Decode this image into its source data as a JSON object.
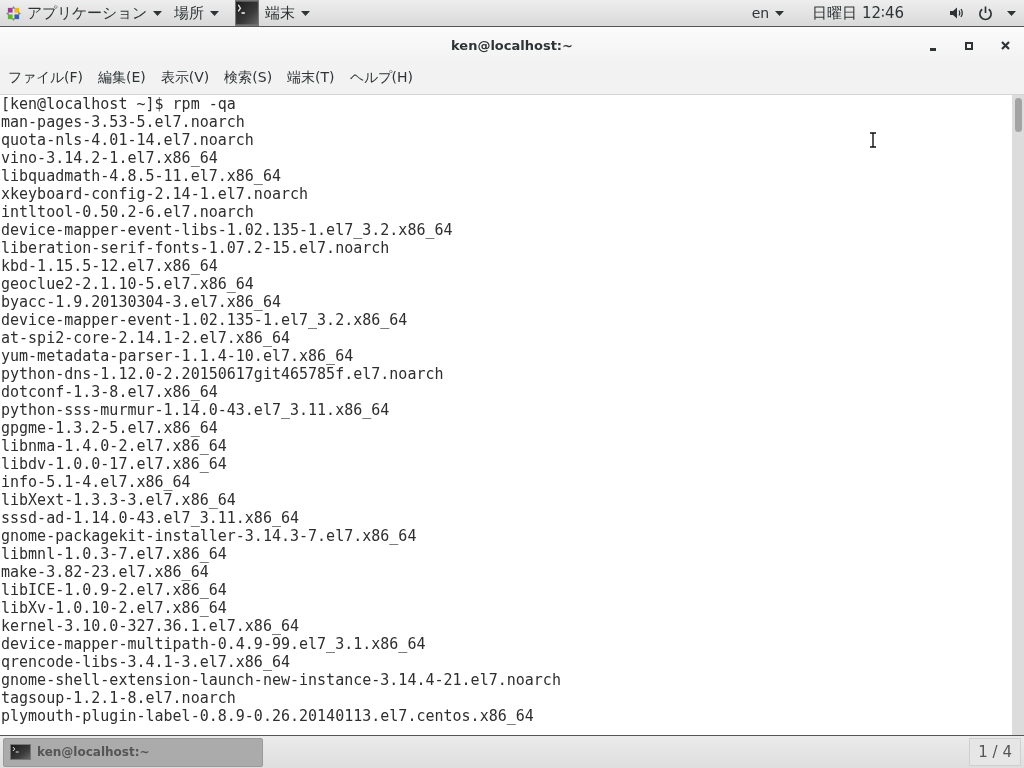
{
  "top_bar": {
    "menus": [
      {
        "kind": "applications",
        "label": "アプリケーション"
      },
      {
        "kind": "places",
        "label": "場所"
      }
    ],
    "active_app": {
      "label": "端末"
    },
    "input_method": "en",
    "clock": "日曜日 12∶46"
  },
  "window": {
    "title": "ken@localhost:~",
    "menu": [
      "ファイル(F)",
      "編集(E)",
      "表示(V)",
      "検索(S)",
      "端末(T)",
      "ヘルプ(H)"
    ]
  },
  "terminal": {
    "lines": [
      "[ken@localhost ~]$ rpm -qa",
      "man-pages-3.53-5.el7.noarch",
      "quota-nls-4.01-14.el7.noarch",
      "vino-3.14.2-1.el7.x86_64",
      "libquadmath-4.8.5-11.el7.x86_64",
      "xkeyboard-config-2.14-1.el7.noarch",
      "intltool-0.50.2-6.el7.noarch",
      "device-mapper-event-libs-1.02.135-1.el7_3.2.x86_64",
      "liberation-serif-fonts-1.07.2-15.el7.noarch",
      "kbd-1.15.5-12.el7.x86_64",
      "geoclue2-2.1.10-5.el7.x86_64",
      "byacc-1.9.20130304-3.el7.x86_64",
      "device-mapper-event-1.02.135-1.el7_3.2.x86_64",
      "at-spi2-core-2.14.1-2.el7.x86_64",
      "yum-metadata-parser-1.1.4-10.el7.x86_64",
      "python-dns-1.12.0-2.20150617git465785f.el7.noarch",
      "dotconf-1.3-8.el7.x86_64",
      "python-sss-murmur-1.14.0-43.el7_3.11.x86_64",
      "gpgme-1.3.2-5.el7.x86_64",
      "libnma-1.4.0-2.el7.x86_64",
      "libdv-1.0.0-17.el7.x86_64",
      "info-5.1-4.el7.x86_64",
      "libXext-1.3.3-3.el7.x86_64",
      "sssd-ad-1.14.0-43.el7_3.11.x86_64",
      "gnome-packagekit-installer-3.14.3-7.el7.x86_64",
      "libmnl-1.0.3-7.el7.x86_64",
      "make-3.82-23.el7.x86_64",
      "libICE-1.0.9-2.el7.x86_64",
      "libXv-1.0.10-2.el7.x86_64",
      "kernel-3.10.0-327.36.1.el7.x86_64",
      "device-mapper-multipath-0.4.9-99.el7_3.1.x86_64",
      "qrencode-libs-3.4.1-3.el7.x86_64",
      "gnome-shell-extension-launch-new-instance-3.14.4-21.el7.noarch",
      "tagsoup-1.2.1-8.el7.noarch",
      "plymouth-plugin-label-0.8.9-0.26.20140113.el7.centos.x86_64"
    ]
  },
  "taskbar": {
    "tasks": [
      {
        "label": "ken@localhost:~",
        "selected": true
      }
    ],
    "workspace": "1 / 4"
  }
}
